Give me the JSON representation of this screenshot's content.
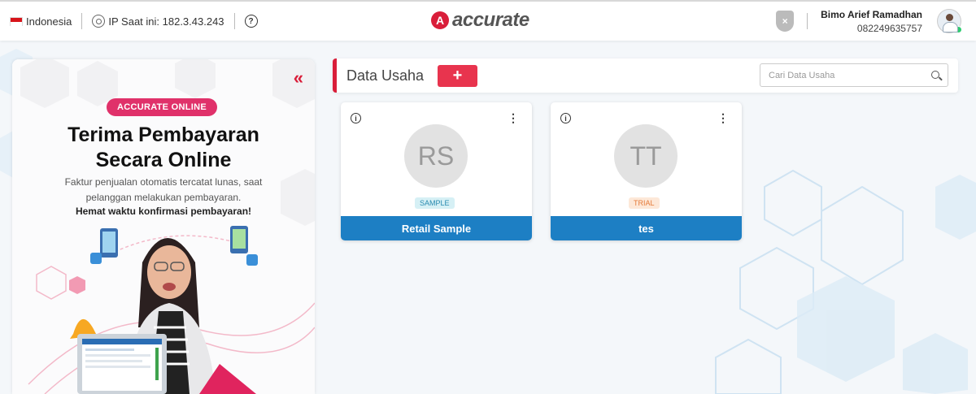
{
  "topbar": {
    "country": "Indonesia",
    "ip_label": "IP Saat ini: 182.3.43.243",
    "help_symbol": "?",
    "logo_mark": "A",
    "logo_text": "accurate",
    "shield_symbol": "×",
    "user_name": "Bimo Arief Ramadhan",
    "user_phone": "082249635757"
  },
  "promo": {
    "collapse_symbol": "«",
    "badge": "ACCURATE ONLINE",
    "title_line1": "Terima Pembayaran",
    "title_line2": "Secara Online",
    "desc_line1": "Faktur penjualan otomatis  tercatat lunas, saat",
    "desc_line2": "pelanggan melakukan pembayaran.",
    "strong": "Hemat waktu konfirmasi pembayaran!"
  },
  "main": {
    "title": "Data Usaha",
    "add_symbol": "+",
    "search_placeholder": "Cari Data Usaha",
    "cards": [
      {
        "initials": "RS",
        "badge": "SAMPLE",
        "name": "Retail Sample"
      },
      {
        "initials": "TT",
        "badge": "TRIAL",
        "name": "tes"
      }
    ],
    "info_symbol": "i",
    "menu_symbol": "⋮"
  },
  "colors": {
    "brand_red": "#d91e3a",
    "card_footer_blue": "#1d7fc4",
    "badge_pink": "#e0316a"
  },
  "icons": [
    "flag-icon",
    "location-pin-icon",
    "help-icon",
    "shield-icon",
    "avatar",
    "double-chevron-left-icon",
    "plus-icon",
    "search-icon",
    "info-icon",
    "more-vertical-icon"
  ]
}
